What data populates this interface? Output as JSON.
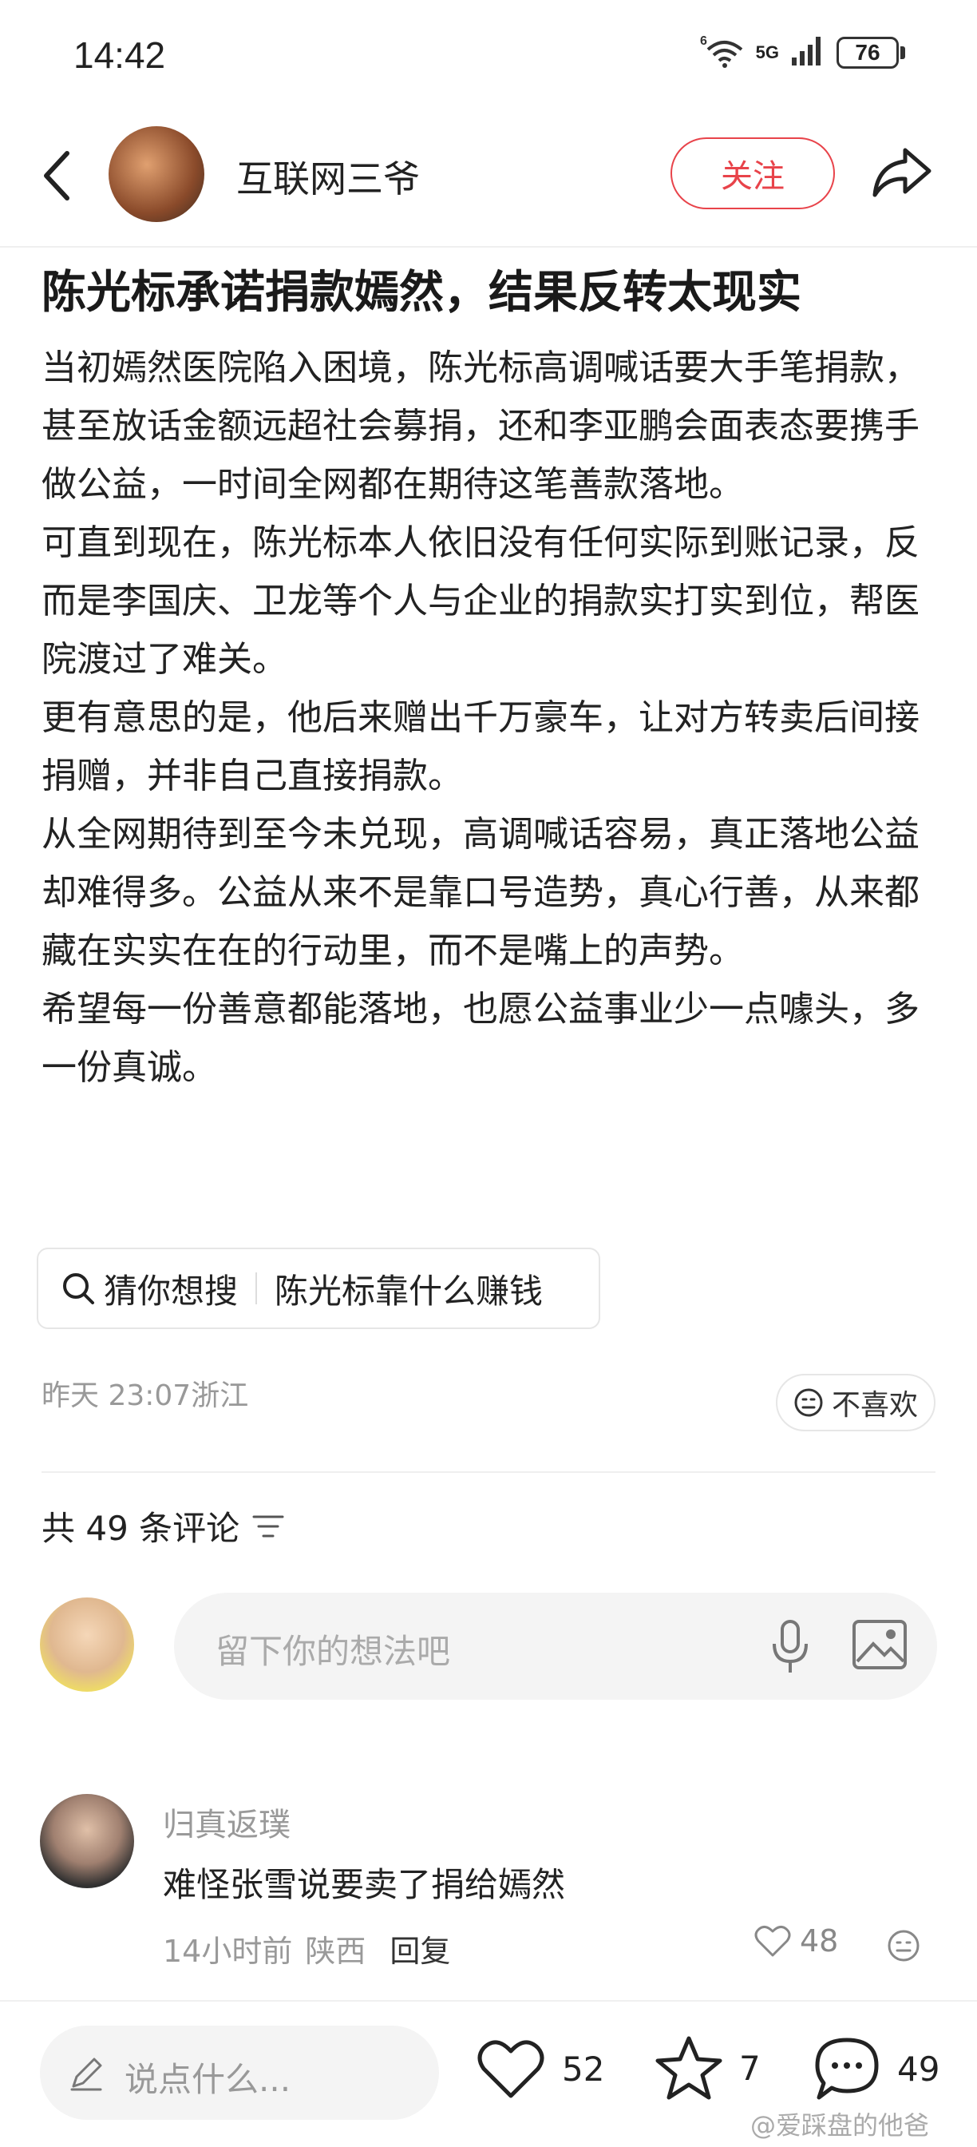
{
  "status_bar": {
    "time": "14:42",
    "battery": "76",
    "signal": "5G",
    "wifi_label": "6"
  },
  "header": {
    "author_name": "互联网三爷",
    "follow_label": "关注"
  },
  "article": {
    "title": "陈光标承诺捐款嫣然，结果反转太现实",
    "paragraphs": [
      "当初嫣然医院陷入困境，陈光标高调喊话要大手笔捐款，甚至放话金额远超社会募捐，还和李亚鹏会面表态要携手做公益，一时间全网都在期待这笔善款落地。",
      "可直到现在，陈光标本人依旧没有任何实际到账记录，反而是李国庆、卫龙等个人与企业的捐款实打实到位，帮医院渡过了难关。",
      "更有意思的是，他后来赠出千万豪车，让对方转卖后间接捐赠，并非自己直接捐款。",
      "从全网期待到至今未兑现，高调喊话容易，真正落地公益却难得多。公益从来不是靠口号造势，真心行善，从来都藏在实实在在的行动里，而不是嘴上的声势。",
      "希望每一份善意都能落地，也愿公益事业少一点噱头，多一份真诚。"
    ],
    "search_prefix": "猜你想搜",
    "search_term": "陈光标靠什么赚钱",
    "meta_time": "昨天 23:07浙江",
    "dislike_label": "不喜欢"
  },
  "comments": {
    "title": "共 49 条评论",
    "input_placeholder": "留下你的想法吧",
    "items": [
      {
        "user": "归真返璞",
        "text": "难怪张雪说要卖了捐给嫣然",
        "time": "14小时前",
        "location": "陕西",
        "reply_label": "回复",
        "likes": "48"
      }
    ]
  },
  "bottom_bar": {
    "input_placeholder": "说点什么...",
    "likes": "52",
    "favorites": "7",
    "comments": "49"
  },
  "watermark": "@爱踩盘的他爸"
}
